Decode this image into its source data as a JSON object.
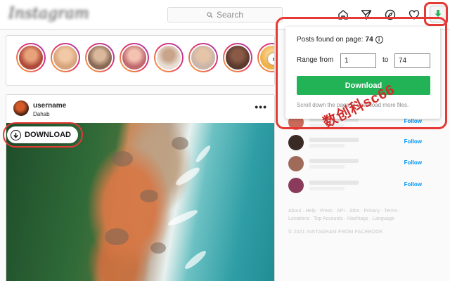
{
  "topbar": {
    "logo_text": "Instagram",
    "search_placeholder": "Search",
    "icons": [
      "home-icon",
      "direct-icon",
      "explore-icon",
      "heart-icon",
      "extension-download-icon"
    ]
  },
  "stories": {
    "avatar_colors": [
      "#b04a3a",
      "#d7a57c",
      "#8a6a55",
      "#c06a70",
      "#e8ded4",
      "#c9b6a8",
      "#5a3a2e",
      "#f0b04a"
    ]
  },
  "post": {
    "username": "username",
    "location": "Dahab",
    "more_label": "•••",
    "download_label": "DOWNLOAD"
  },
  "suggestions": {
    "follow_label": "Follow",
    "avatar_colors": [
      "#c96a5a",
      "#3a2a26",
      "#a06a58",
      "#8a3a5a"
    ]
  },
  "footer": {
    "links": "About · Help · Press · API · Jobs · Privacy · Terms · Locations · Top Accounts · Hashtags · Language",
    "copyright": "© 2021 INSTAGRAM FROM FACEBOOK"
  },
  "popup": {
    "found_label": "Posts found on page:",
    "found_count": "74",
    "range_label": "Range from",
    "range_from": "1",
    "to_label": "to",
    "range_to": "74",
    "download_label": "Download",
    "note": "Scroll down the page to download more files."
  },
  "watermark": "数创科sc66",
  "colors": {
    "accent_green": "#21b356",
    "highlight_red": "#e53935",
    "follow_blue": "#0095f6"
  }
}
